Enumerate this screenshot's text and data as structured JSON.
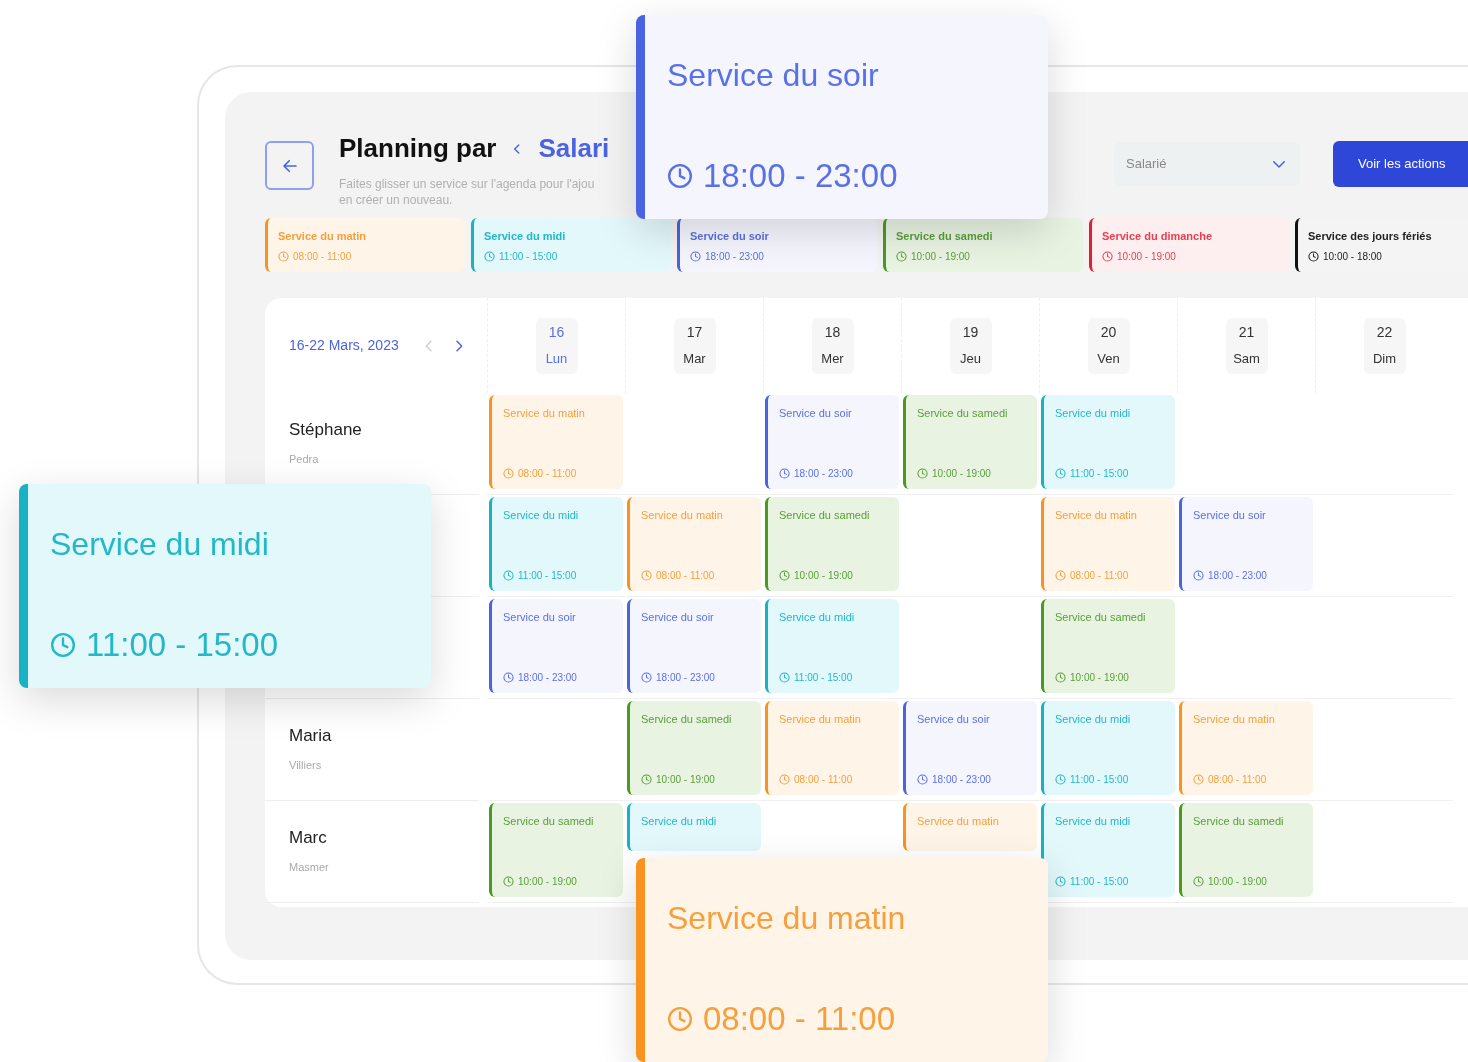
{
  "header": {
    "title": "Planning par",
    "breadcrumb": "Salari",
    "subtitle_lines": [
      "Faites glisser un service sur l'agenda pour l'ajou",
      "en créer un nouveau."
    ],
    "dropdown": {
      "value": "Salarié"
    },
    "action_button": "Voir les actions"
  },
  "legend": [
    {
      "kind": "matin",
      "title": "Service du matin",
      "time": "08:00 - 11:00"
    },
    {
      "kind": "midi",
      "title": "Service du midi",
      "time": "11:00 - 15:00"
    },
    {
      "kind": "soir",
      "title": "Service du soir",
      "time": "18:00 - 23:00"
    },
    {
      "kind": "samedi",
      "title": "Service du samedi",
      "time": "10:00 - 19:00"
    },
    {
      "kind": "dimanche",
      "title": "Service du dimanche",
      "time": "10:00 - 19:00"
    },
    {
      "kind": "feries",
      "title": "Service des jours fériés",
      "time": "10:00 - 18:00"
    }
  ],
  "calendar": {
    "range": "16-22 Mars, 2023",
    "prev_disabled": true,
    "next_disabled": false,
    "days": [
      {
        "number": "16",
        "label": "Lun",
        "selected": true
      },
      {
        "number": "17",
        "label": "Mar",
        "selected": false
      },
      {
        "number": "18",
        "label": "Mer",
        "selected": false
      },
      {
        "number": "19",
        "label": "Jeu",
        "selected": false
      },
      {
        "number": "20",
        "label": "Ven",
        "selected": false
      },
      {
        "number": "21",
        "label": "Sam",
        "selected": false
      },
      {
        "number": "22",
        "label": "Dim",
        "selected": false
      }
    ],
    "employees": [
      {
        "name": "Stéphane",
        "surname": "Pedra",
        "shifts": [
          {
            "kind": "matin",
            "title": "Service du matin",
            "time": "08:00 - 11:00"
          },
          {
            "kind": "empty"
          },
          {
            "kind": "soir",
            "title": "Service du soir",
            "time": "18:00 - 23:00"
          },
          {
            "kind": "samedi",
            "title": "Service du samedi",
            "time": "10:00 - 19:00"
          },
          {
            "kind": "midi",
            "title": "Service du midi",
            "time": "11:00 - 15:00"
          },
          {
            "kind": "empty"
          },
          {
            "kind": "empty"
          }
        ]
      },
      {
        "shifts": [
          {
            "kind": "midi",
            "title": "Service du midi",
            "time": "11:00 - 15:00"
          },
          {
            "kind": "matin",
            "title": "Service du matin",
            "time": "08:00 - 11:00"
          },
          {
            "kind": "samedi",
            "title": "Service du samedi",
            "time": "10:00 - 19:00"
          },
          {
            "kind": "empty"
          },
          {
            "kind": "matin",
            "title": "Service du matin",
            "time": "08:00 - 11:00"
          },
          {
            "kind": "soir",
            "title": "Service du soir",
            "time": "18:00 - 23:00"
          },
          {
            "kind": "empty"
          }
        ]
      },
      {
        "shifts": [
          {
            "kind": "soir",
            "title": "Service du soir",
            "time": "18:00 - 23:00"
          },
          {
            "kind": "soir",
            "title": "Service du soir",
            "time": "18:00 - 23:00"
          },
          {
            "kind": "midi",
            "title": "Service du midi",
            "time": "11:00 - 15:00"
          },
          {
            "kind": "empty"
          },
          {
            "kind": "samedi",
            "title": "Service du samedi",
            "time": "10:00 - 19:00"
          },
          {
            "kind": "empty"
          },
          {
            "kind": "empty"
          }
        ]
      },
      {
        "name": "Maria",
        "surname": "Villiers",
        "shifts": [
          {
            "kind": "empty"
          },
          {
            "kind": "samedi",
            "title": "Service du samedi",
            "time": "10:00 - 19:00"
          },
          {
            "kind": "matin",
            "title": "Service du matin",
            "time": "08:00 - 11:00"
          },
          {
            "kind": "soir",
            "title": "Service du soir",
            "time": "18:00 - 23:00"
          },
          {
            "kind": "midi",
            "title": "Service du midi",
            "time": "11:00 - 15:00"
          },
          {
            "kind": "matin",
            "title": "Service du matin",
            "time": "08:00 - 11:00"
          },
          {
            "kind": "empty"
          }
        ]
      },
      {
        "name": "Marc",
        "surname": "Masmer",
        "shifts": [
          {
            "kind": "samedi",
            "title": "Service du samedi",
            "time": "10:00 - 19:00"
          },
          {
            "kind": "midi",
            "title": "Service du midi"
          },
          {
            "kind": "empty"
          },
          {
            "kind": "matin",
            "title": "Service du matin"
          },
          {
            "kind": "midi",
            "title": "Service du midi",
            "time": "11:00 - 15:00"
          },
          {
            "kind": "samedi",
            "title": "Service du samedi",
            "time": "10:00 - 19:00"
          },
          {
            "kind": "empty"
          }
        ]
      }
    ]
  },
  "floating_cards": [
    {
      "kind": "soir",
      "title": "Service du soir",
      "time": "18:00 - 23:00"
    },
    {
      "kind": "midi",
      "title": "Service du midi",
      "time": "11:00 - 15:00"
    },
    {
      "kind": "matin",
      "title": "Service du matin",
      "time": "08:00 - 11:00"
    }
  ]
}
